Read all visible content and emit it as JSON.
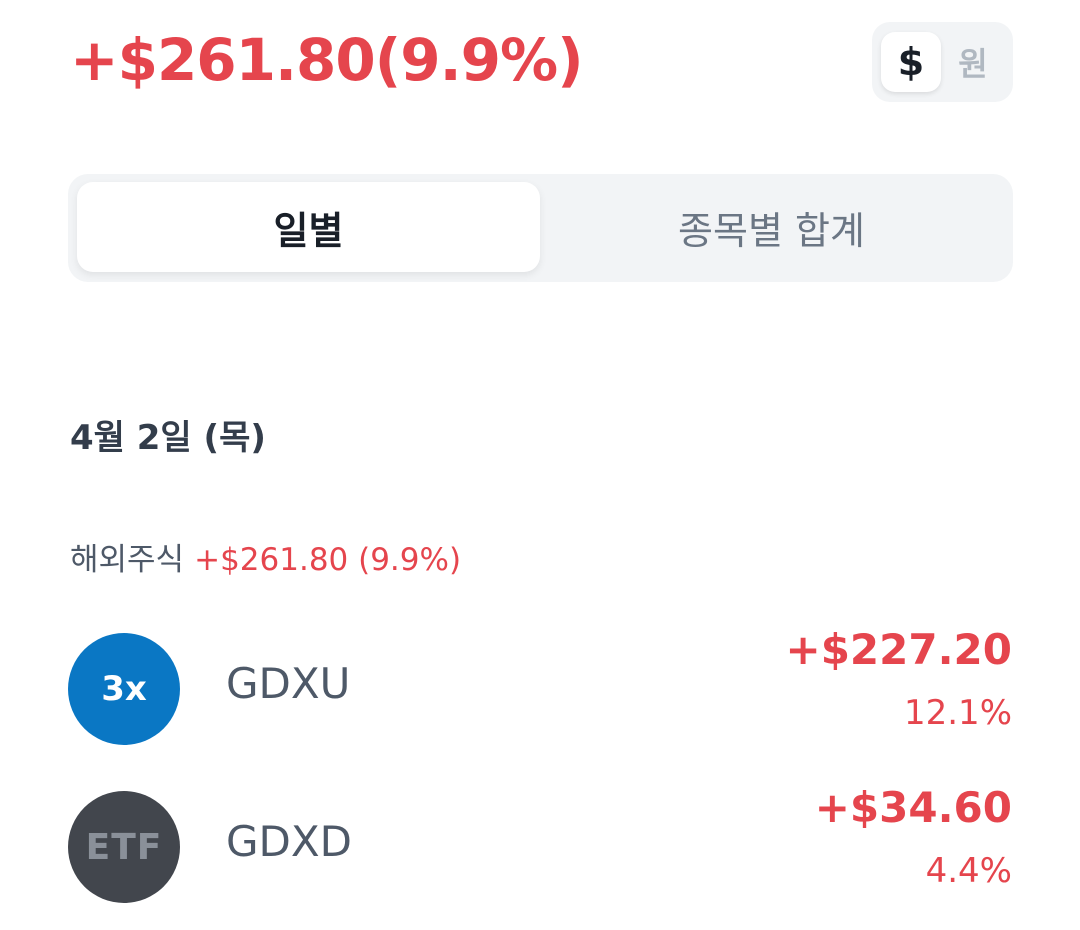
{
  "header": {
    "total_profit": "+$261.80(9.9%)"
  },
  "currency_toggle": {
    "usd_label": "$",
    "krw_label": "원",
    "selected": "usd"
  },
  "tabs": [
    {
      "label": "일별",
      "active": true
    },
    {
      "label": "종목별 합계",
      "active": false
    }
  ],
  "date_group": {
    "date": "4월 2일 (목)",
    "category_label": "해외주식",
    "category_profit": "+$261.80 (9.9%)"
  },
  "stocks": [
    {
      "logo_text": "3x",
      "name": "GDXU",
      "amount": "+$227.20",
      "percent": "12.1%"
    },
    {
      "logo_text": "ETF",
      "name": "GDXD",
      "amount": "+$34.60",
      "percent": "4.4%"
    }
  ],
  "colors": {
    "gain": "#e5454d",
    "logo_blue": "#0a77c4",
    "logo_dark": "#42464d"
  }
}
